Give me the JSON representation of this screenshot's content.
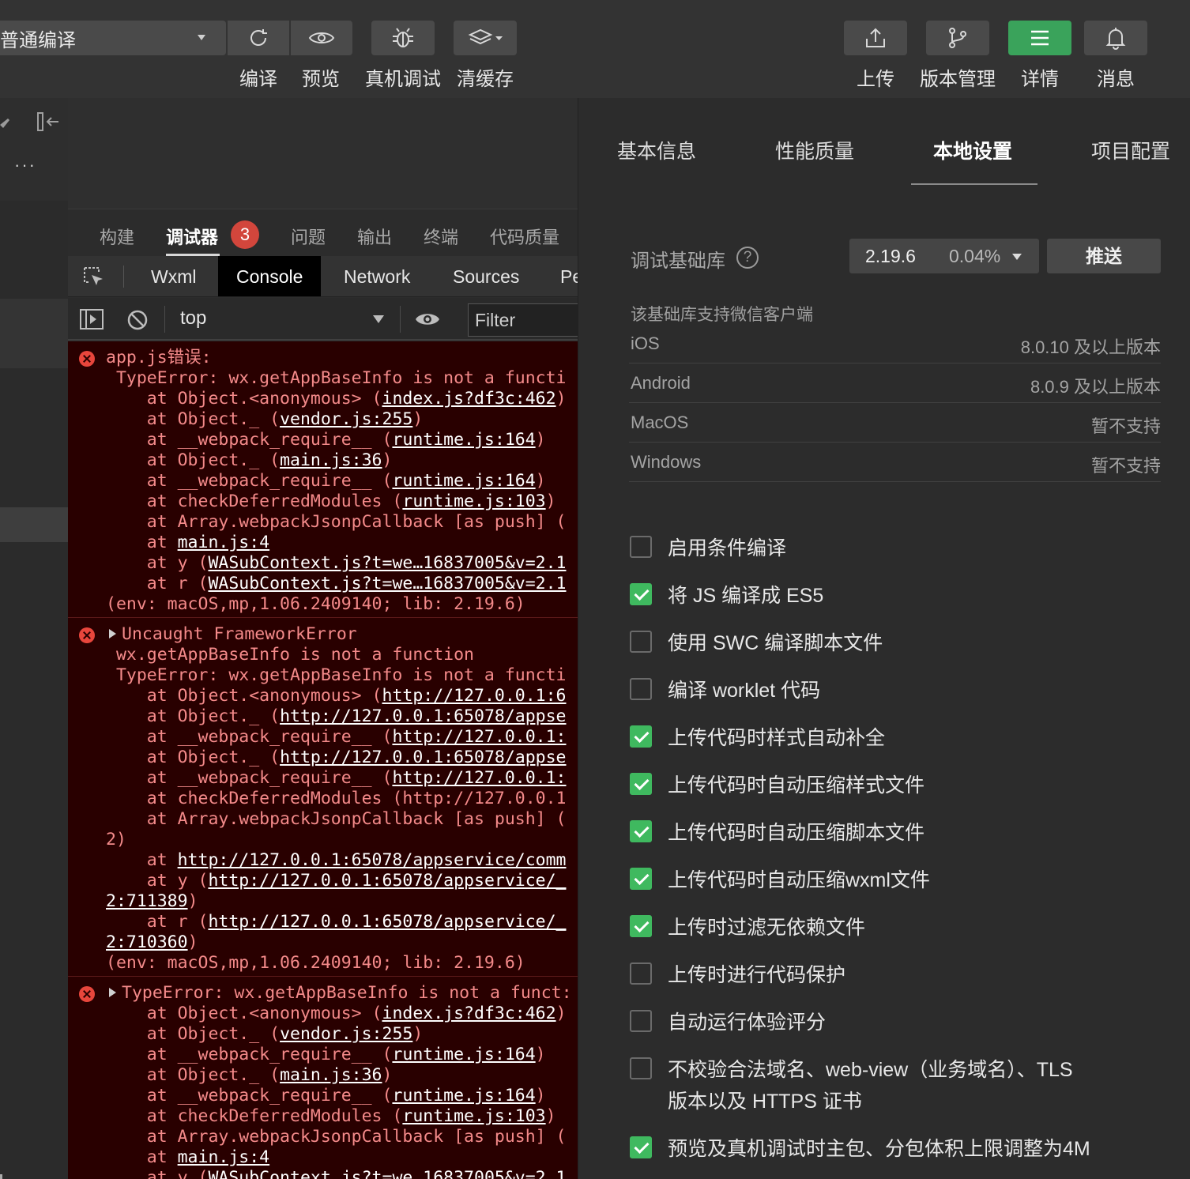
{
  "toolbar": {
    "mode": "普通编译",
    "left_buttons": [
      {
        "label": "编译",
        "icon": "refresh-icon"
      },
      {
        "label": "预览",
        "icon": "eye-icon"
      },
      {
        "label": "真机调试",
        "icon": "bug-icon"
      },
      {
        "label": "清缓存",
        "icon": "layers-icon"
      }
    ],
    "right_buttons": [
      {
        "label": "上传",
        "icon": "upload-icon"
      },
      {
        "label": "版本管理",
        "icon": "branch-icon"
      },
      {
        "label": "详情",
        "icon": "menu-icon"
      },
      {
        "label": "消息",
        "icon": "bell-icon"
      }
    ]
  },
  "left_strip": {
    "more_label": "···"
  },
  "debug_tabs": {
    "items": [
      "构建",
      "调试器",
      "问题",
      "输出",
      "终端",
      "代码质量"
    ],
    "active": "调试器",
    "badge_count": "3"
  },
  "devtools_tabs": {
    "items": [
      "Wxml",
      "Console",
      "Network",
      "Sources",
      "Pe"
    ],
    "active": "Console"
  },
  "console_bar": {
    "context": "top",
    "filter_placeholder": "Filter"
  },
  "console": {
    "entries": [
      {
        "lines": [
          "app.js错误:",
          " TypeError: wx.getAppBaseInfo is not a functi",
          "    at Object.<anonymous> (index.js?df3c:462)",
          "    at Object._ (vendor.js:255)",
          "    at __webpack_require__ (runtime.js:164)",
          "    at Object._ (main.js:36)",
          "    at __webpack_require__ (runtime.js:164)",
          "    at checkDeferredModules (runtime.js:103)",
          "    at Array.webpackJsonpCallback [as push] (",
          "    at main.js:4",
          "    at y (WASubContext.js?t=we…16837005&v=2.1",
          "    at r (WASubContext.js?t=we…16837005&v=2.1",
          "(env: macOS,mp,1.06.2409140; lib: 2.19.6)"
        ]
      },
      {
        "lines": [
          "Uncaught FrameworkError",
          " wx.getAppBaseInfo is not a function",
          " TypeError: wx.getAppBaseInfo is not a functi",
          "    at Object.<anonymous> (http://127.0.0.1:6",
          "    at Object._ (http://127.0.0.1:65078/appse",
          "    at __webpack_require__ (http://127.0.0.1:",
          "    at Object._ (http://127.0.0.1:65078/appse",
          "    at __webpack_require__ (http://127.0.0.1:",
          "    at checkDeferredModules (http://127.0.0.1",
          "    at Array.webpackJsonpCallback [as push] (",
          "2)",
          "    at http://127.0.0.1:65078/appservice/comm",
          "    at y (http://127.0.0.1:65078/appservice/_",
          "2:711389)",
          "    at r (http://127.0.0.1:65078/appservice/_",
          "2:710360)",
          "(env: macOS,mp,1.06.2409140; lib: 2.19.6)"
        ]
      },
      {
        "lines": [
          "TypeError: wx.getAppBaseInfo is not a funct:",
          "    at Object.<anonymous> (index.js?df3c:462)",
          "    at Object._ (vendor.js:255)",
          "    at __webpack_require__ (runtime.js:164)",
          "    at Object._ (main.js:36)",
          "    at __webpack_require__ (runtime.js:164)",
          "    at checkDeferredModules (runtime.js:103)",
          "    at Array.webpackJsonpCallback [as push] (",
          "    at main.js:4",
          "    at y (WASubContext.js?t=we…16837005&v=2.1"
        ]
      }
    ]
  },
  "panel": {
    "tabs": [
      "基本信息",
      "性能质量",
      "本地设置",
      "项目配置"
    ],
    "active_tab": "本地设置",
    "lib_label": "调试基础库",
    "help": "?",
    "lib_version": "2.19.6",
    "lib_percent": "0.04%",
    "push_label": "推送",
    "support_title": "该基础库支持微信客户端",
    "support": [
      {
        "platform": "iOS",
        "value": "8.0.10 及以上版本"
      },
      {
        "platform": "Android",
        "value": "8.0.9 及以上版本"
      },
      {
        "platform": "MacOS",
        "value": "暂不支持"
      },
      {
        "platform": "Windows",
        "value": "暂不支持"
      }
    ],
    "options": [
      {
        "label": "启用条件编译",
        "checked": false
      },
      {
        "label": "将 JS 编译成 ES5",
        "checked": true
      },
      {
        "label": "使用 SWC 编译脚本文件",
        "checked": false
      },
      {
        "label": "编译 worklet 代码",
        "checked": false
      },
      {
        "label": "上传代码时样式自动补全",
        "checked": true
      },
      {
        "label": "上传代码时自动压缩样式文件",
        "checked": true
      },
      {
        "label": "上传代码时自动压缩脚本文件",
        "checked": true
      },
      {
        "label": "上传代码时自动压缩wxml文件",
        "checked": true
      },
      {
        "label": "上传时过滤无依赖文件",
        "checked": true
      },
      {
        "label": "上传时进行代码保护",
        "checked": false
      },
      {
        "label": "自动运行体验评分",
        "checked": false
      },
      {
        "label": "不校验合法域名、web-view（业务域名）、TLS",
        "label2": "版本以及 HTTPS 证书",
        "checked": false
      },
      {
        "label": "预览及真机调试时主包、分包体积上限调整为4M",
        "checked": true
      }
    ]
  }
}
